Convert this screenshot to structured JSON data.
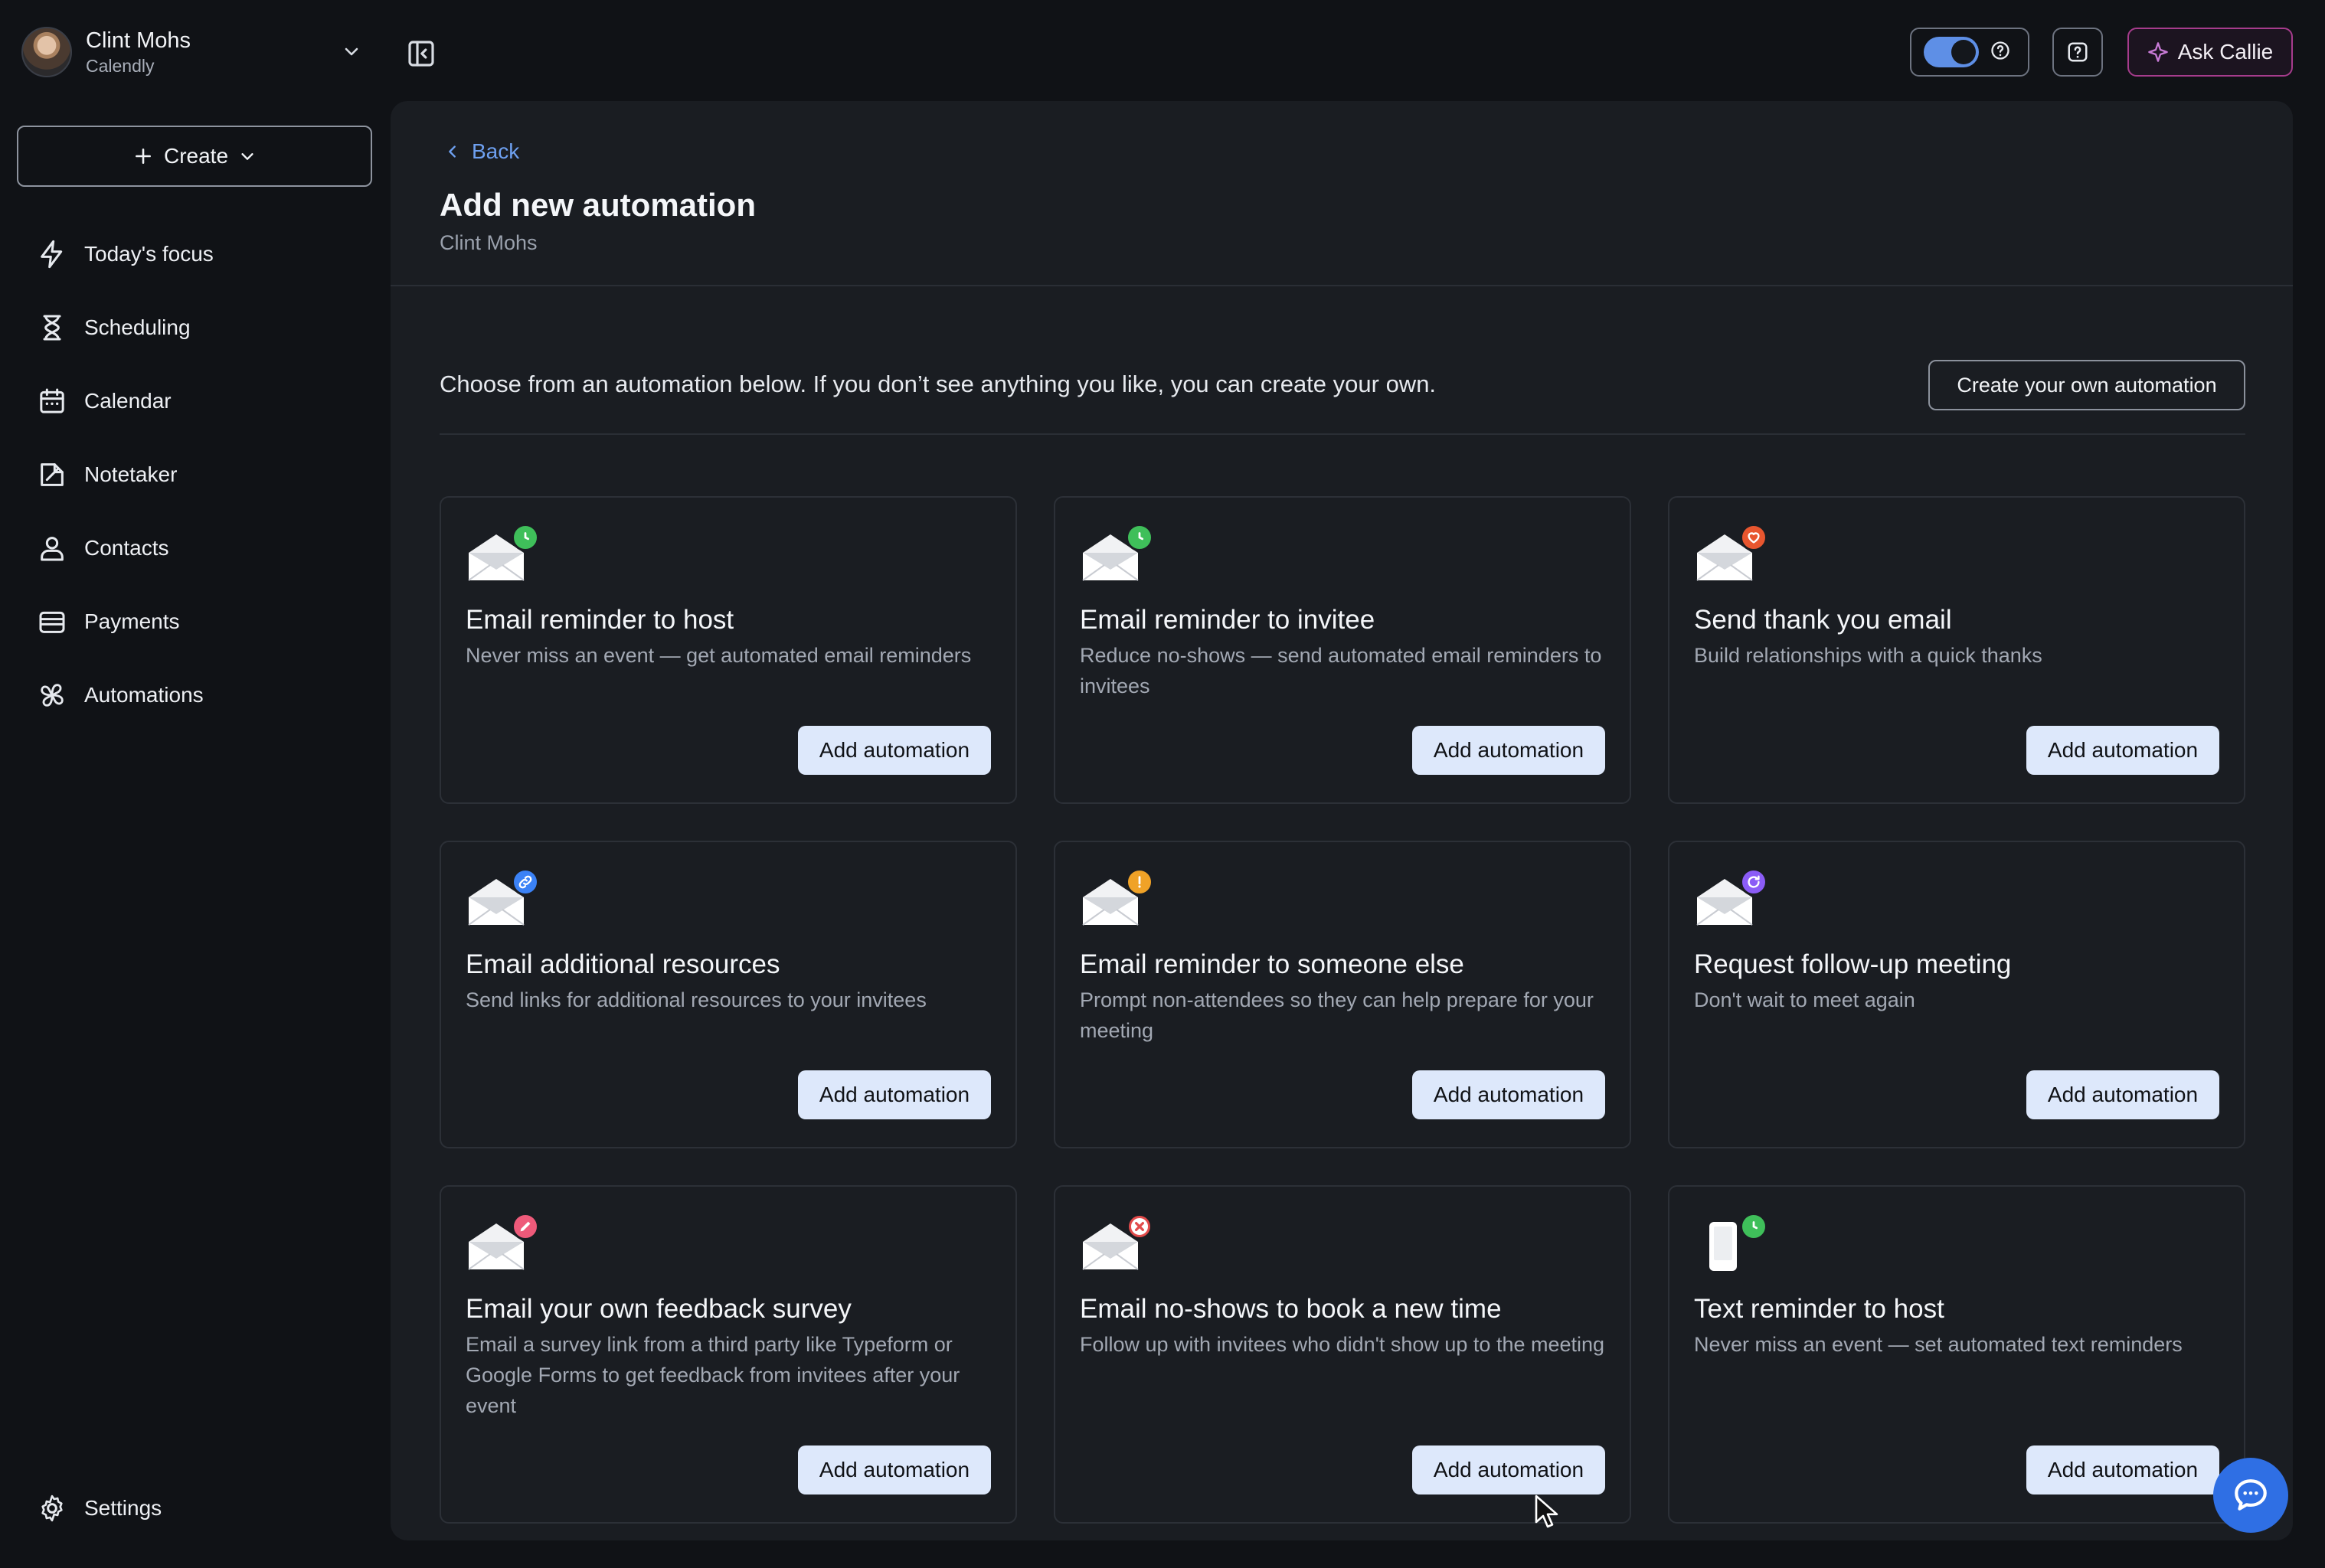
{
  "user": {
    "name": "Clint Mohs",
    "org": "Calendly"
  },
  "sidebar": {
    "create_label": "Create",
    "items": [
      {
        "label": "Today's focus",
        "icon": "bolt-icon"
      },
      {
        "label": "Scheduling",
        "icon": "hourglass-icon"
      },
      {
        "label": "Calendar",
        "icon": "calendar-icon"
      },
      {
        "label": "Notetaker",
        "icon": "notetaker-icon"
      },
      {
        "label": "Contacts",
        "icon": "contacts-icon"
      },
      {
        "label": "Payments",
        "icon": "wallet-icon"
      },
      {
        "label": "Automations",
        "icon": "automations-icon"
      }
    ],
    "settings_label": "Settings"
  },
  "topbar": {
    "ask_label": "Ask Callie",
    "toggle_on": true
  },
  "page": {
    "back_label": "Back",
    "title": "Add new automation",
    "subtitle": "Clint Mohs",
    "intro": "Choose from an automation below. If you don’t see anything you like, you can create your own.",
    "create_own_label": "Create your own automation"
  },
  "cards": [
    {
      "title": "Email reminder to host",
      "desc": "Never miss an event — get automated email reminders",
      "button": "Add automation",
      "badge_color": "#3fbf5a",
      "badge_icon": "clock-icon",
      "icon_type": "envelope"
    },
    {
      "title": "Email reminder to invitee",
      "desc": "Reduce no-shows — send automated email reminders to invitees",
      "button": "Add automation",
      "badge_color": "#3fbf5a",
      "badge_icon": "clock-icon",
      "icon_type": "envelope"
    },
    {
      "title": "Send thank you email",
      "desc": "Build relationships with a quick thanks",
      "button": "Add automation",
      "badge_color": "#e8562f",
      "badge_icon": "heart-icon",
      "icon_type": "envelope"
    },
    {
      "title": "Email additional resources",
      "desc": "Send links for additional resources to your invitees",
      "button": "Add automation",
      "badge_color": "#3b82f6",
      "badge_icon": "link-icon",
      "icon_type": "envelope"
    },
    {
      "title": "Email reminder to someone else",
      "desc": "Prompt non-attendees so they can help prepare for your meeting",
      "button": "Add automation",
      "badge_color": "#f0a227",
      "badge_icon": "exclamation-icon",
      "icon_type": "envelope"
    },
    {
      "title": "Request follow-up meeting",
      "desc": "Don't wait to meet again",
      "button": "Add automation",
      "badge_color": "#8b5cf6",
      "badge_icon": "refresh-icon",
      "icon_type": "envelope"
    },
    {
      "title": "Email your own feedback survey",
      "desc": "Email a survey link from a third party like Typeform or Google Forms to get feedback from invitees after your event",
      "button": "Add automation",
      "badge_color": "#ee5a7a",
      "badge_icon": "pencil-icon",
      "icon_type": "envelope"
    },
    {
      "title": "Email no-shows to book a new time",
      "desc": "Follow up with invitees who didn't show up to the meeting",
      "button": "Add automation",
      "badge_color": "#ffffff",
      "badge_icon": "x-circle-icon",
      "icon_type": "envelope"
    },
    {
      "title": "Text reminder to host",
      "desc": "Never miss an event — set automated text reminders",
      "button": "Add automation",
      "badge_color": "#3fbf5a",
      "badge_icon": "clock-icon",
      "icon_type": "phone"
    }
  ]
}
